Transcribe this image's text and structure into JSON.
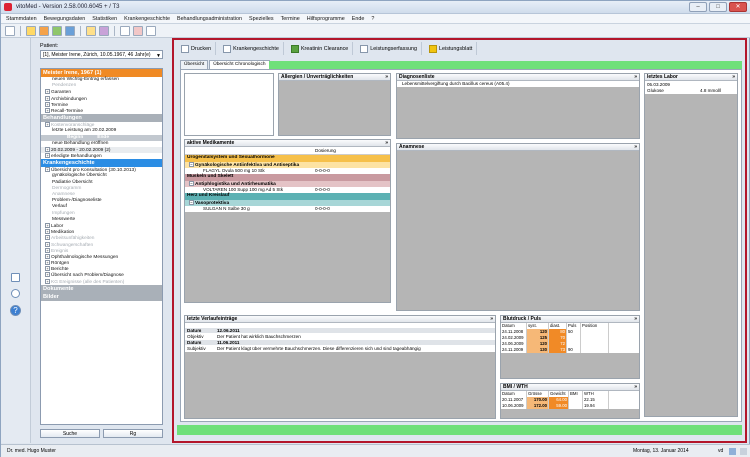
{
  "window": {
    "title": "vitoMed - Version 2.58.000.6045 + / T3",
    "buttons": [
      "–",
      "□",
      "✕"
    ]
  },
  "menu": [
    "Stammdaten",
    "Bewegungsdaten",
    "Statistiken",
    "Krankengeschichte",
    "Behandlungsadministration",
    "Spezielles",
    "Termine",
    "Hilfsprogramme",
    "Ende",
    "?"
  ],
  "nav": {
    "patient_label": "Patient:",
    "patient_value": "[1], Meister Irene, Zürich, 10.05.1967, 46 Jahr(e)",
    "sec1": "Meister Irene, 1967 (1)",
    "sec1_items": [
      {
        "t": "neuen Wichtig-Eintrag erfassen",
        "pm": "",
        "dim": false
      },
      {
        "t": "Pendenzen",
        "pm": "",
        "dim": true
      },
      {
        "t": "Garanten",
        "pm": "+",
        "dim": false
      },
      {
        "t": "Archivbindungen",
        "pm": "+",
        "dim": false
      },
      {
        "t": "Termine",
        "pm": "+",
        "dim": false
      },
      {
        "t": "Recall-Termine",
        "pm": "+",
        "dim": false
      }
    ],
    "sec2": "Behandlungen",
    "sec2_items": [
      {
        "t": "Kostenvoranschläge",
        "pm": "+",
        "dim": true
      },
      {
        "t": "letzte Leistung am 20.02.2009",
        "pm": "",
        "dim": false
      }
    ],
    "col_begin": "Beginn",
    "col_end": "Ende",
    "sec2_items2": [
      {
        "t": "neue Behandlung eröffnen",
        "pm": "",
        "dim": false,
        "band": false
      },
      {
        "t": "20.02.2009 - 20.02.2009  (2)",
        "pm": "+",
        "dim": false,
        "band": true
      },
      {
        "t": "erledigte Behandlungen",
        "pm": "+",
        "dim": false,
        "band": false
      }
    ],
    "sec3": "Krankengeschichte",
    "sec3_items": [
      {
        "t": "Übersicht pro Konsultation (30.10.2013)",
        "pm": "+",
        "dim": false
      },
      {
        "t": "gynäkologische Übersicht",
        "pm": "",
        "dim": false
      },
      {
        "t": "Pädiatrie Übersicht",
        "pm": "",
        "dim": false
      },
      {
        "t": "Dermogramm",
        "pm": "",
        "dim": true
      },
      {
        "t": "Anamnese",
        "pm": "",
        "dim": true
      },
      {
        "t": "Problem-/Diagnoseliste",
        "pm": "",
        "dim": false
      },
      {
        "t": "Verlauf",
        "pm": "",
        "dim": false
      },
      {
        "t": "Impfungen",
        "pm": "",
        "dim": true
      },
      {
        "t": "Messwerte",
        "pm": "",
        "dim": false
      },
      {
        "t": "Labor",
        "pm": "+",
        "dim": false
      },
      {
        "t": "Medikation",
        "pm": "+",
        "dim": false
      },
      {
        "t": "Arbeitsunfähigkeiten",
        "pm": "+",
        "dim": true
      },
      {
        "t": "Schwangerschaften",
        "pm": "+",
        "dim": true
      },
      {
        "t": "Ereignis",
        "pm": "+",
        "dim": true
      },
      {
        "t": "Ophthalmologische Messungen",
        "pm": "+",
        "dim": false
      },
      {
        "t": "Röntgen",
        "pm": "+",
        "dim": false
      },
      {
        "t": "Berichte",
        "pm": "+",
        "dim": false
      },
      {
        "t": "Übersicht nach Problem/Diagnose",
        "pm": "+",
        "dim": false
      },
      {
        "t": "KG Ereignisse (alle des Patienten)",
        "pm": "+",
        "dim": true
      }
    ],
    "sec4": "Dokumente",
    "sec5": "Bilder",
    "btn_search": "Suche",
    "btn_right": "Rg"
  },
  "actions": [
    "Drucken",
    "Krankengeschichte",
    "Kreatinin Clearance",
    "Leistungserfassung",
    "Leistungsblatt"
  ],
  "tabs": [
    "Übersicht",
    "Übersicht Chronologisch"
  ],
  "allergien": {
    "title": "Allergien / Unverträglichkeiten"
  },
  "diagnosen": {
    "title": "Diagnosenliste",
    "item": "Lebensmittelvergiftung durch Bacillus cereus (A05.4)"
  },
  "labor": {
    "title": "letztes Labor",
    "date": "05.03.2009",
    "item": "Glukose",
    "value": "4.8 mmol/l"
  },
  "medi": {
    "title": "aktive Medikamente",
    "col": "Dosierung",
    "groups": [
      {
        "name": "Urogenitalsystem und Sexualhormone",
        "color": "#f6c04a",
        "sub": "Gynäkologische Antiinfektiva und Antiseptika",
        "subcolor": "#fde3a3",
        "drug": "FLAGYL Ovula 500 mg 10 Stk",
        "dose": "0-0-0-0"
      },
      {
        "name": "Muskeln und Skelett",
        "color": "#c99aa0",
        "sub": "Antiphlogistika und Antirheumatika",
        "subcolor": "#e4c3c6",
        "drug": "VOLTAREN 100 Supp 100 mg Ad 5 Stk",
        "dose": "0-0-0-0"
      },
      {
        "name": "Herz und Kreislauf",
        "color": "#5cb1b3",
        "sub": "Vasoprotektiva",
        "subcolor": "#a7d6d7",
        "drug": "SULGAN N Salbe 30 g",
        "dose": "0-0-0-0"
      }
    ]
  },
  "anamnese": {
    "title": "Anamnese"
  },
  "verlauf": {
    "title": "letzte Verlaufeinträge",
    "rows": [
      {
        "k": "Datum",
        "v": "12.06.2011",
        "dark": true
      },
      {
        "k": "Objektiv",
        "v": "Der Patient hat wirklich Bauchschmerzen",
        "dark": false
      },
      {
        "k": "Datum",
        "v": "11.06.2011",
        "dark": true
      },
      {
        "k": "Subjektiv",
        "v": "Der Patient klagt über vermehrte Bauchschmerzen. Diese differenzieren sich und sind tageabhängig",
        "dark": false
      }
    ]
  },
  "bp": {
    "title": "Blutdruck / Puls",
    "cols": [
      "Datum",
      "syst.",
      "diast.",
      "Puls",
      "Position"
    ],
    "rows": [
      {
        "d": "24.11.2008",
        "s": "120",
        "di": "80",
        "p": "50"
      },
      {
        "d": "24.02.2009",
        "s": "125",
        "di": "70",
        "p": ""
      },
      {
        "d": "24.06.2009",
        "s": "120",
        "di": "72",
        "p": ""
      },
      {
        "d": "24.11.2009",
        "s": "130",
        "di": "73",
        "p": "90"
      }
    ]
  },
  "bmi": {
    "title": "BMI / WTH",
    "cols": [
      "Datum",
      "Grösse",
      "Gewicht",
      "BMI",
      "WTH"
    ],
    "rows": [
      {
        "d": "20.11.2007",
        "g": "170.00",
        "w": "64.00",
        "b": "",
        "t": "22.15"
      },
      {
        "d": "10.06.2009",
        "g": "172.00",
        "w": "59.00",
        "b": "",
        "t": "19.94"
      }
    ]
  },
  "status": {
    "user": "Dr. med. Hugo Muster",
    "date": "Montag, 13. Januar 2014",
    "code": "vd"
  }
}
